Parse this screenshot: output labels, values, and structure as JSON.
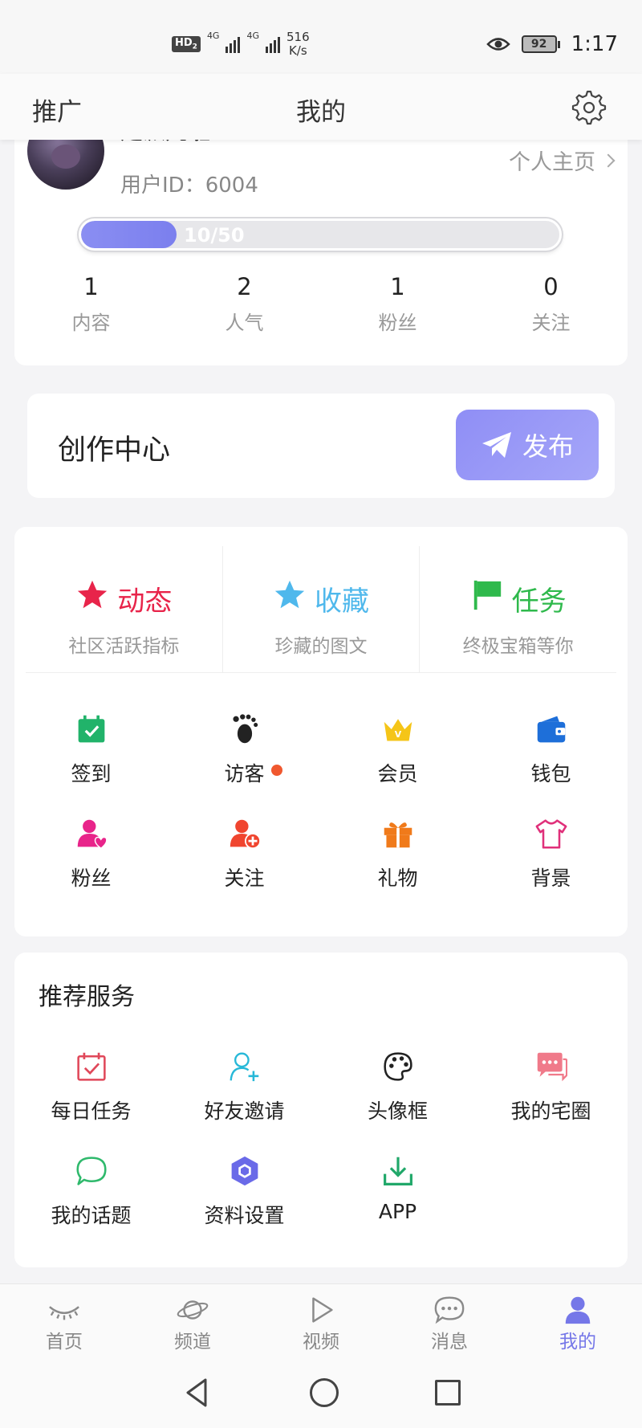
{
  "status": {
    "hd_badge": "HD",
    "hd_sub": "2",
    "net1": "4G",
    "net2": "4G",
    "speed_value": "516",
    "speed_unit": "K/s",
    "battery": "92",
    "time": "1:17"
  },
  "topbar": {
    "left_label": "推广",
    "title": "我的"
  },
  "profile": {
    "username": "走派几啦",
    "user_id": "用户ID：6004",
    "homepage_link": "个人主页",
    "level_text": "10/50",
    "level_fraction": 0.2,
    "stats": [
      {
        "num": "1",
        "label": "内容"
      },
      {
        "num": "2",
        "label": "人气"
      },
      {
        "num": "1",
        "label": "粉丝"
      },
      {
        "num": "0",
        "label": "关注"
      }
    ]
  },
  "creator": {
    "title": "创作中心",
    "publish_label": "发布"
  },
  "features": [
    {
      "title": "动态",
      "subtitle": "社区活跃指标",
      "color": "#e8244a",
      "icon": "star-icon"
    },
    {
      "title": "收藏",
      "subtitle": "珍藏的图文",
      "color": "#4fb8ec",
      "icon": "star-icon"
    },
    {
      "title": "任务",
      "subtitle": "终极宝箱等你",
      "color": "#2fb94c",
      "icon": "flag-icon"
    }
  ],
  "grid": [
    {
      "label": "签到",
      "icon": "calendar-check-icon",
      "color": "#21b36a"
    },
    {
      "label": "访客",
      "icon": "footprint-icon",
      "color": "#222222",
      "dot": true
    },
    {
      "label": "会员",
      "icon": "crown-icon",
      "color": "#f5c518"
    },
    {
      "label": "钱包",
      "icon": "wallet-icon",
      "color": "#1e6fd9"
    },
    {
      "label": "粉丝",
      "icon": "fan-user-icon",
      "color": "#e8248a"
    },
    {
      "label": "关注",
      "icon": "add-user-icon",
      "color": "#f0452f"
    },
    {
      "label": "礼物",
      "icon": "gift-icon",
      "color": "#f07a1a"
    },
    {
      "label": "背景",
      "icon": "tshirt-icon",
      "color": "#e0307a"
    }
  ],
  "services": {
    "title": "推荐服务",
    "items": [
      {
        "label": "每日任务",
        "icon": "daily-task-icon",
        "color": "#e0485a"
      },
      {
        "label": "好友邀请",
        "icon": "invite-friend-icon",
        "color": "#27b8d8"
      },
      {
        "label": "头像框",
        "icon": "palette-icon",
        "color": "#222222"
      },
      {
        "label": "我的宅圈",
        "icon": "chat-bubbles-icon",
        "color": "#f07a8a"
      },
      {
        "label": "我的话题",
        "icon": "topic-bubble-icon",
        "color": "#2fb96c"
      },
      {
        "label": "资料设置",
        "icon": "hexagon-settings-icon",
        "color": "#6a6ae8"
      },
      {
        "label": "APP",
        "icon": "download-icon",
        "color": "#21a86a"
      }
    ]
  },
  "tabs": [
    {
      "label": "首页",
      "icon": "eye-closed-icon",
      "active": false
    },
    {
      "label": "频道",
      "icon": "planet-icon",
      "active": false
    },
    {
      "label": "视频",
      "icon": "play-icon",
      "active": false
    },
    {
      "label": "消息",
      "icon": "message-icon",
      "active": false
    },
    {
      "label": "我的",
      "icon": "user-icon",
      "active": true
    }
  ],
  "colors": {
    "accent": "#7577e8",
    "notification_dot": "#f0582f"
  }
}
